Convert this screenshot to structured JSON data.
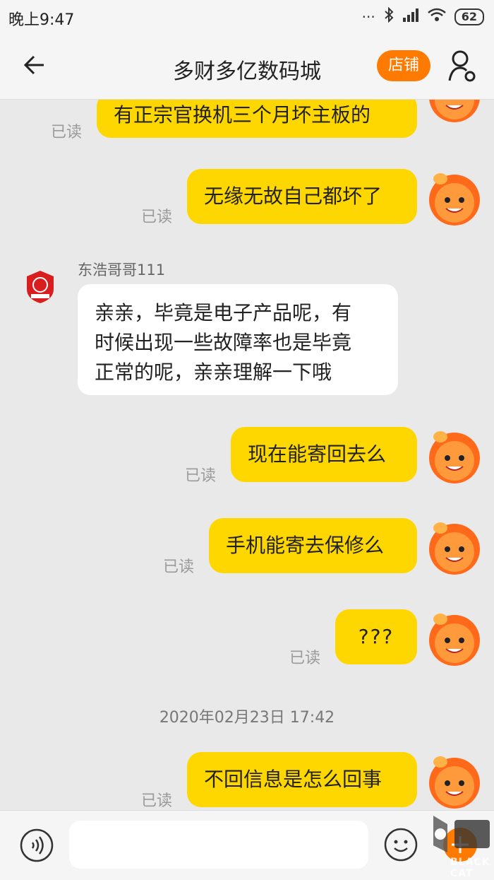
{
  "status_bar": {
    "time": "晚上9:47",
    "battery": "62"
  },
  "header": {
    "title": "多财多亿数码城",
    "shop_button": "店铺"
  },
  "messages": [
    {
      "text": "有正宗官换机三个月坏主板的",
      "read_label": "已读"
    },
    {
      "text": "无缘无故自己都坏了",
      "read_label": "已读"
    },
    {
      "sender": "东浩哥哥111",
      "text_lines": [
        "亲亲，毕竟是电子产品呢，有",
        "时候出现一些故障率也是毕竟",
        "正常的呢，亲亲理解一下哦"
      ]
    },
    {
      "text": "现在能寄回去么",
      "read_label": "已读"
    },
    {
      "text": "手机能寄去保修么",
      "read_label": "已读"
    },
    {
      "text": "???",
      "read_label": "已读"
    },
    {
      "timestamp": "2020年02月23日 17:42"
    },
    {
      "text": "不回信息是怎么回事",
      "read_label": "已读"
    }
  ],
  "input": {
    "placeholder": ""
  },
  "watermark": {
    "text": "BLACK CAT"
  },
  "colors": {
    "accent": "#ff7a00",
    "bubble_out": "#ffd700",
    "bubble_in": "#ffffff"
  }
}
